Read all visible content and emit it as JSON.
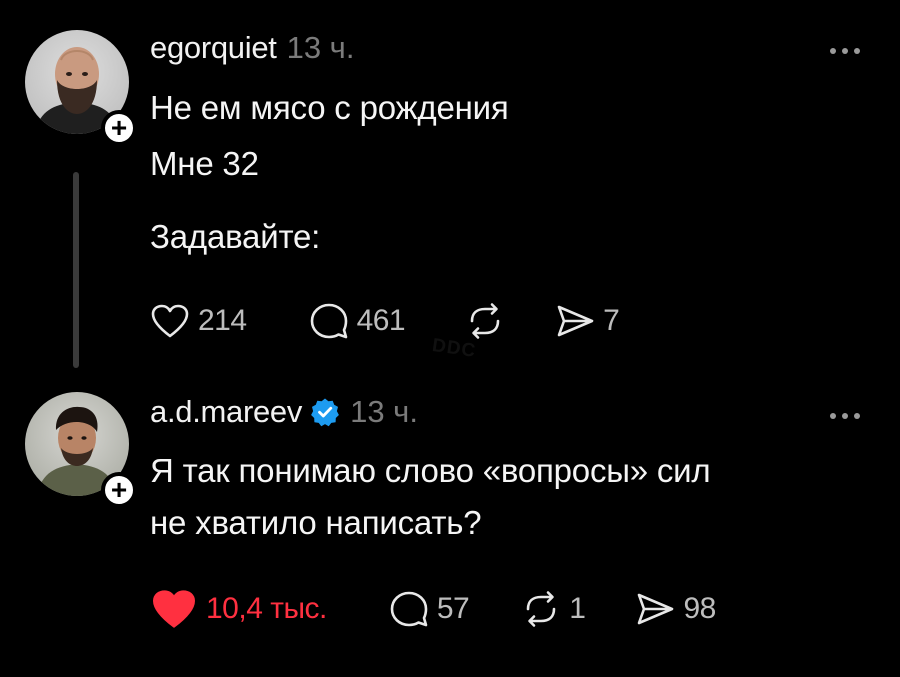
{
  "posts": [
    {
      "username": "egorquiet",
      "time": "13 ч.",
      "verified": false,
      "lines": [
        "Не ем мясо с рождения",
        "Мне 32",
        "Задавайте:"
      ],
      "likes": "214",
      "replies": "461",
      "reposts": "",
      "shares": "7",
      "liked": false,
      "avatar_icon": "bald-bearded-man-avatar"
    },
    {
      "username": "a.d.mareev",
      "time": "13 ч.",
      "verified": true,
      "lines": [
        "Я так понимаю слово «вопросы» сил",
        "не хватило написать?"
      ],
      "likes": "10,4 тыс.",
      "replies": "57",
      "reposts": "1",
      "shares": "98",
      "liked": true,
      "avatar_icon": "young-man-avatar"
    }
  ],
  "watermark": "DDC",
  "colors": {
    "background": "#000000",
    "like_active": "#ff3040",
    "verified": "#1d9bf0",
    "muted": "#7b7b7b"
  },
  "icons": {
    "follow": "plus-icon",
    "more": "more-dots-icon",
    "like": "heart-icon",
    "reply": "comment-bubble-icon",
    "repost": "repost-icon",
    "share": "send-icon",
    "verified": "verified-badge-icon"
  }
}
